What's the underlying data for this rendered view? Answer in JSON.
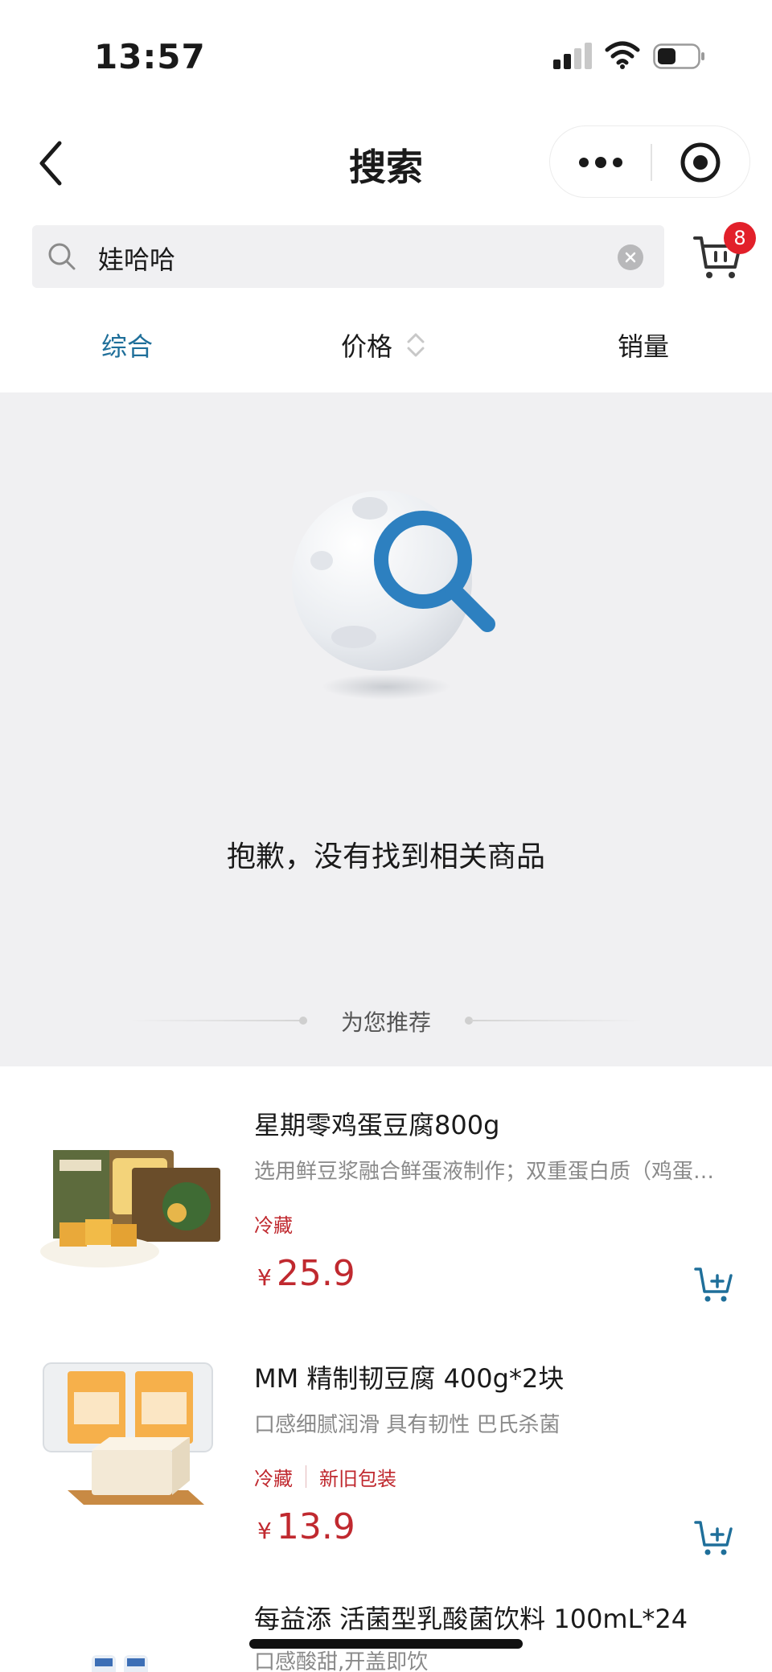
{
  "status_bar": {
    "time": "13:57"
  },
  "nav": {
    "title": "搜索"
  },
  "search": {
    "value": "娃哈哈",
    "cart_count": "8"
  },
  "sort_tabs": [
    {
      "label": "综合",
      "active": true
    },
    {
      "label": "价格",
      "active": false
    },
    {
      "label": "销量",
      "active": false
    }
  ],
  "empty_state": {
    "message": "抱歉，没有找到相关商品",
    "recommend_label": "为您推荐"
  },
  "products": [
    {
      "name": "星期零鸡蛋豆腐800g",
      "desc": "选用鲜豆浆融合鲜蛋液制作；双重蛋白质（鸡蛋…",
      "tags": [
        "冷藏"
      ],
      "currency": "¥",
      "price": "25.9",
      "image_icon": "tofu-box-package-icon"
    },
    {
      "name": "MM 精制韧豆腐 400g*2块",
      "desc": "口感细腻润滑 具有韧性 巴氏杀菌",
      "tags": [
        "冷藏",
        "新旧包装"
      ],
      "currency": "¥",
      "price": "13.9",
      "image_icon": "tofu-block-icon"
    },
    {
      "name": "每益添 活菌型乳酸菌饮料 100mL*24",
      "desc": "口感酸甜,开盖即饮",
      "image_icon": "drink-bottles-icon"
    }
  ],
  "colors": {
    "accent_blue": "#1f6f9a",
    "price_red": "#c0292f",
    "badge_red": "#e2202a",
    "empty_bg": "#f0f0f2"
  }
}
